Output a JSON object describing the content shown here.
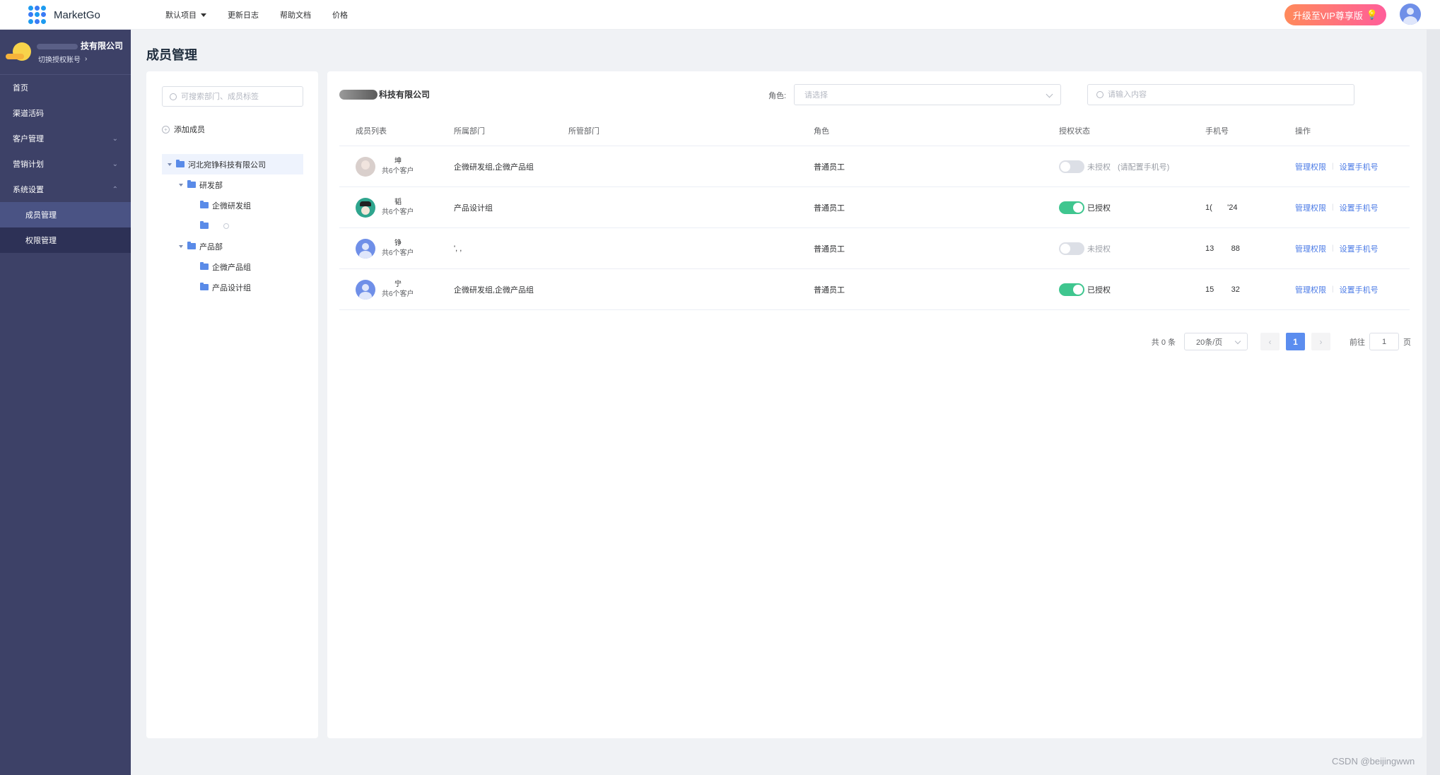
{
  "app": {
    "name": "MarketGo"
  },
  "topnav": {
    "items": [
      {
        "label": "默认项目",
        "has_dropdown": true
      },
      {
        "label": "更新日志"
      },
      {
        "label": "帮助文档"
      },
      {
        "label": "价格"
      }
    ],
    "vip_label": "升级至VIP尊享版",
    "vip_icon": "lightbulb-icon"
  },
  "sidebar": {
    "company": "技有限公司",
    "switch_label": "切换授权账号",
    "menu": [
      {
        "label": "首页"
      },
      {
        "label": "渠道活码"
      },
      {
        "label": "客户管理",
        "arrow": "⌄"
      },
      {
        "label": "营销计划",
        "arrow": "⌄"
      },
      {
        "label": "系统设置",
        "arrow": "⌃"
      },
      {
        "label": "成员管理",
        "sub": true,
        "active": true
      },
      {
        "label": "权限管理",
        "sub": true
      }
    ]
  },
  "page": {
    "title": "成员管理"
  },
  "tree_panel": {
    "search_placeholder": "可搜索部门、成员标签",
    "add_member": "添加成员",
    "nodes": [
      {
        "label": "河北宛铮科技有限公司",
        "level": 0,
        "expanded": true
      },
      {
        "label": "研发部",
        "level": 1,
        "expanded": true
      },
      {
        "label": "企微研发组",
        "level": 2
      },
      {
        "label": "",
        "level": 2
      },
      {
        "label": "产品部",
        "level": 1,
        "expanded": true
      },
      {
        "label": "企微产品组",
        "level": 2
      },
      {
        "label": "产品设计组",
        "level": 2
      }
    ]
  },
  "main": {
    "org_name": "科技有限公司",
    "role_label": "角色:",
    "role_placeholder": "请选择",
    "search_placeholder": "请输入内容",
    "columns": [
      "成员列表",
      "所属部门",
      "所管部门",
      "角色",
      "授权状态",
      "手机号",
      "操作"
    ],
    "rows": [
      {
        "name": "坤",
        "count": "共6个客户",
        "dept": "企微研发组,企微产品组",
        "managed": "",
        "role": "普通员工",
        "authorized": false,
        "auth_text": "未授权",
        "auth_hint": "(请配置手机号)",
        "phone": "",
        "ops": [
          "管理权限",
          "设置手机号"
        ],
        "avatar": "photo"
      },
      {
        "name": "韬",
        "count": "共6个客户",
        "dept": "产品设计组",
        "managed": "",
        "role": "普通员工",
        "authorized": true,
        "auth_text": "已授权",
        "auth_hint": "",
        "phone": "1(       '24",
        "ops": [
          "管理权限",
          "设置手机号"
        ],
        "avatar": "dark"
      },
      {
        "name": "铮",
        "count": "共6个客户",
        "dept": "', ,",
        "managed": "",
        "role": "普通员工",
        "authorized": false,
        "auth_text": "未授权",
        "auth_hint": "",
        "phone": "13        88",
        "ops": [
          "管理权限",
          "设置手机号"
        ],
        "avatar": "blue"
      },
      {
        "name": "宁",
        "count": "共6个客户",
        "dept": "企微研发组,企微产品组",
        "managed": "",
        "role": "普通员工",
        "authorized": true,
        "auth_text": "已授权",
        "auth_hint": "",
        "phone": "15        32",
        "ops": [
          "管理权限",
          "设置手机号"
        ],
        "avatar": "blue"
      }
    ],
    "pagination": {
      "total": "共 0 条",
      "page_size": "20条/页",
      "prev": "‹",
      "current": "1",
      "next": "›",
      "goto_label": "前往",
      "goto_value": "1",
      "page_suffix": "页"
    }
  },
  "watermark": "CSDN @beijingwwn",
  "colors": {
    "sidebar_bg": "#3d4167",
    "accent": "#5b8def",
    "toggle_on": "#3fc68f",
    "vip_start": "#ff8a5b",
    "vip_end": "#ff5e9a"
  }
}
